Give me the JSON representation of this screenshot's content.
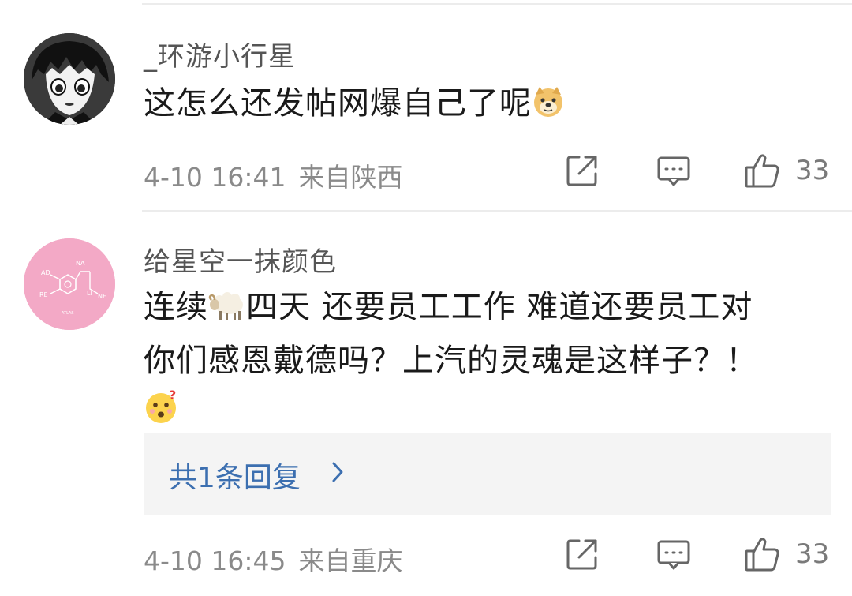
{
  "comments": [
    {
      "username": "_环游小行星",
      "text": "这怎么还发帖网爆自己了呢",
      "emoji": "doge-emoji",
      "date": "4-10 16:41",
      "location": "来自陕西",
      "likes": "33"
    },
    {
      "username": "给星空一抹颜色",
      "text_part1": "连续",
      "sheep_emoji": "sheep-emoji",
      "text_part2": "四天 还要员工工作 难道还要员工对",
      "text_line2": "你们感恩戴德吗？上汽的灵魂是这样子？！",
      "emoji": "confused-face-emoji",
      "avatar_labels": [
        "AD",
        "NA",
        "RE",
        "LI",
        "NE",
        "ATLAS"
      ],
      "reply_summary": "共1条回复",
      "date": "4-10 16:45",
      "location": "来自重庆",
      "likes": "33"
    }
  ],
  "colors": {
    "reply_link": "#3c6fb0",
    "meta_text": "#8a8a8a",
    "reply_bg": "#f4f4f4",
    "avatar2_bg": "#f3a9c6"
  },
  "icons": [
    "share-icon",
    "comment-icon",
    "like-icon",
    "chevron-right-icon"
  ]
}
